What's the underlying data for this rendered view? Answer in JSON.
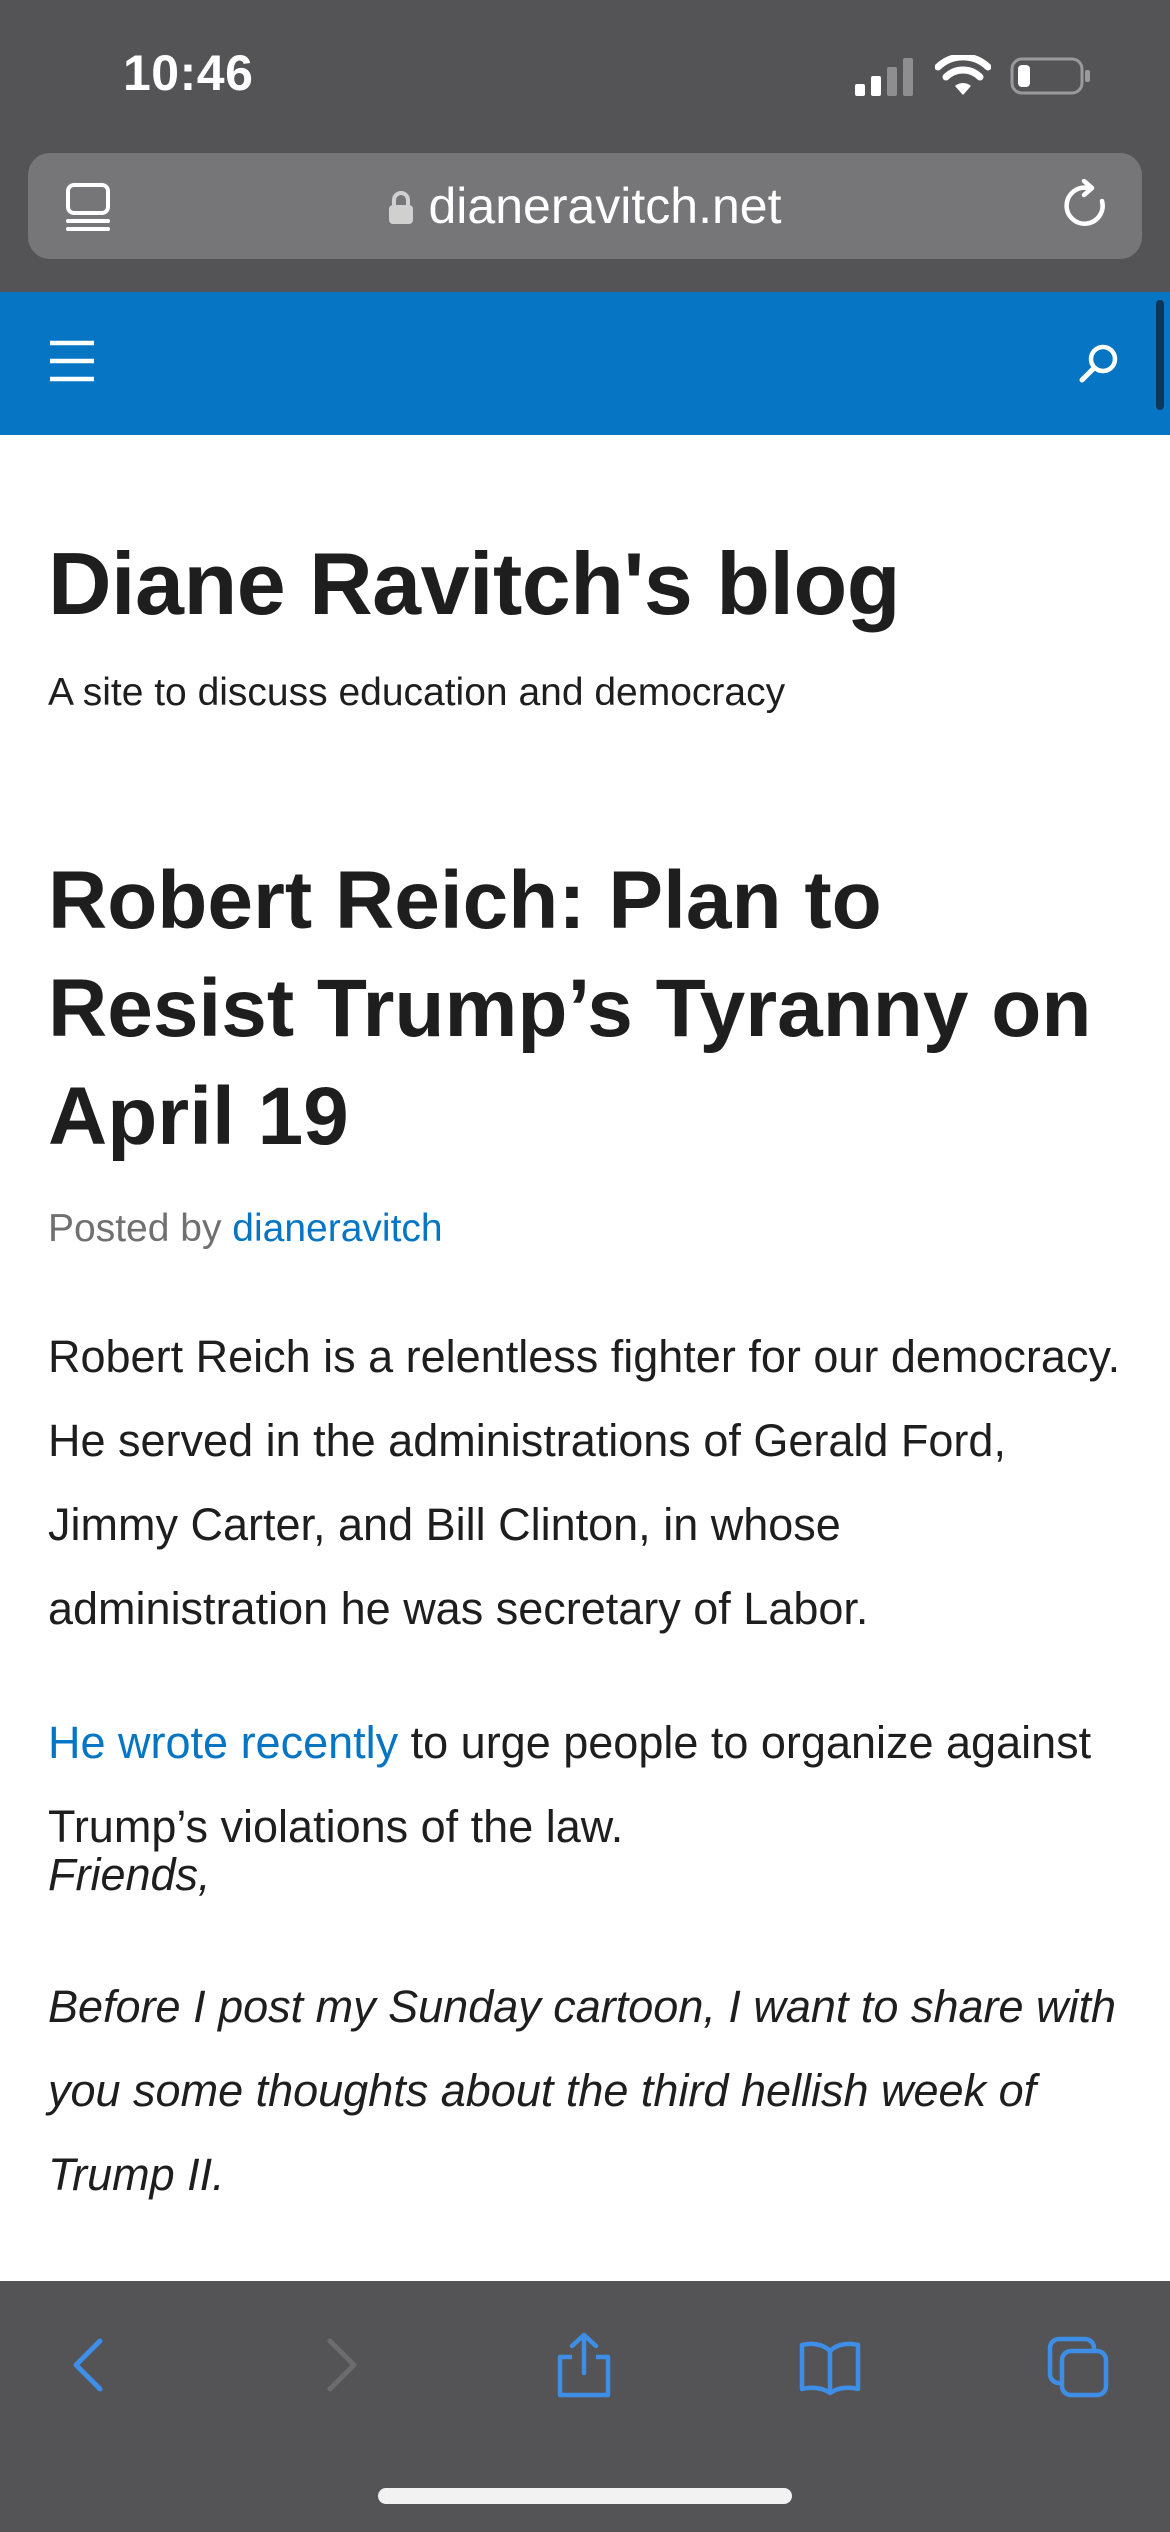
{
  "status_bar": {
    "time": "10:46"
  },
  "browser": {
    "url": "dianeravitch.net"
  },
  "site": {
    "title": "Diane Ravitch's blog",
    "tagline": "A site to discuss education and democracy"
  },
  "post": {
    "title": "Robert Reich: Plan to Resist Trump’s Tyranny on April 19",
    "byline_prefix": "Posted by",
    "author": "dianeravitch",
    "paragraph1": "Robert Reich is a relentless fighter for our democracy. He served in the administrations of Gerald Ford, Jimmy Carter, and Bill Clinton, in whose administration he was secretary of Labor.",
    "paragraph2_link": "He wrote recently",
    "paragraph2_rest": " to urge people to organize against Trump’s violations of the law.",
    "paragraph3": "Friends,",
    "paragraph4": "Before I post my Sunday cartoon, I want to share with you some thoughts about the third hellish week of Trump II."
  },
  "toolbar": {
    "icons": [
      "back-icon",
      "forward-icon",
      "share-icon",
      "bookmarks-icon",
      "tabs-icon"
    ]
  },
  "colors": {
    "accent": "#0675c4",
    "chrome": "#545456",
    "text": "#1e1e1e"
  }
}
